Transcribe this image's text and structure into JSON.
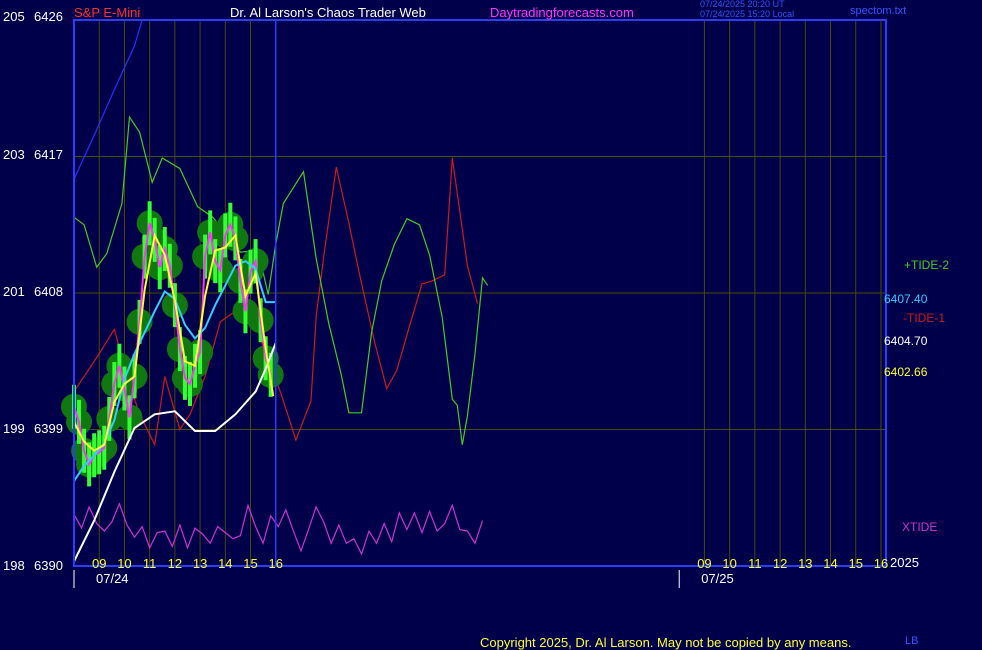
{
  "header": {
    "instrument": "S&P E-Mini",
    "site_title": "Dr. Al Larson's Chaos Trader Web",
    "site_url": "Daytradingforecasts.com",
    "timestamp_utc": "07/24/2025 20:20 UT",
    "timestamp_local": "07/24/2025 15:20 Local",
    "data_file": "spectom.txt"
  },
  "footer": {
    "copyright": "Copyright 2025, Dr. Al Larson. May not be copied by any means.",
    "initials": "LB"
  },
  "colors": {
    "background": "#00004a",
    "frame": "#2a3cff",
    "grid": "#4a4a00",
    "price_bars": "#33ff33",
    "moving_avg_fast": "#ffff33",
    "moving_avg_mid": "#33ccff",
    "moving_avg_slow": "#ffffff",
    "tide1": "#cc1a1a",
    "tide2": "#44cc22",
    "xtide": "#cc33cc",
    "bollinger_upper": "#2233ff"
  },
  "chart_data": {
    "type": "line",
    "title": "S&P E-Mini",
    "left_axis": {
      "labels": [
        {
          "degree": "205",
          "price": "6426"
        },
        {
          "degree": "203",
          "price": "6417"
        },
        {
          "degree": "201",
          "price": "6408"
        },
        {
          "degree": "199",
          "price": "6399"
        },
        {
          "degree": "198",
          "price": "6390"
        }
      ],
      "ylim": [
        6390,
        6426
      ]
    },
    "x_ticks": [
      "09",
      "10",
      "11",
      "12",
      "13",
      "14",
      "15",
      "16",
      "09",
      "10",
      "11",
      "12",
      "13",
      "14",
      "15",
      "16"
    ],
    "x_tick_hours": [
      9,
      10,
      11,
      12,
      13,
      14,
      15,
      16,
      33,
      34,
      35,
      36,
      37,
      38,
      39,
      40
    ],
    "dates": [
      {
        "label": "07/24",
        "hour": 8
      },
      {
        "label": "07/25",
        "hour": 32
      }
    ],
    "xlim": [
      8,
      40.2
    ],
    "now_hour": 16,
    "year_label": "2025",
    "price_labels": [
      {
        "text": "6407.40",
        "color": "#33ccff"
      },
      {
        "text": "6404.70",
        "color": "#ffffff"
      },
      {
        "text": "6402.66",
        "color": "#ffff33"
      }
    ],
    "legend": [
      {
        "text": "+TIDE-2",
        "color": "#44cc22"
      },
      {
        "text": "-TIDE-1",
        "color": "#cc1a1a"
      },
      {
        "text": "XTIDE",
        "color": "#cc33cc"
      }
    ],
    "series": {
      "price_close": [
        [
          8,
          6400.5
        ],
        [
          8.2,
          6399.5
        ],
        [
          8.4,
          6397.6
        ],
        [
          8.6,
          6396.7
        ],
        [
          8.8,
          6397.3
        ],
        [
          9.0,
          6397.5
        ],
        [
          9.2,
          6397.8
        ],
        [
          9.4,
          6399.7
        ],
        [
          9.6,
          6402.0
        ],
        [
          9.8,
          6403.2
        ],
        [
          10.0,
          6401.7
        ],
        [
          10.2,
          6399.8
        ],
        [
          10.4,
          6402.5
        ],
        [
          10.6,
          6406.1
        ],
        [
          10.8,
          6410.4
        ],
        [
          11.0,
          6412.6
        ],
        [
          11.2,
          6411.5
        ],
        [
          11.4,
          6409.7
        ],
        [
          11.6,
          6410.9
        ],
        [
          11.8,
          6409.8
        ],
        [
          12.0,
          6407.2
        ],
        [
          12.2,
          6404.3
        ],
        [
          12.4,
          6402.4
        ],
        [
          12.6,
          6402.0
        ],
        [
          12.8,
          6403.2
        ],
        [
          13.0,
          6404.1
        ],
        [
          13.2,
          6410.4
        ],
        [
          13.4,
          6412.0
        ],
        [
          13.6,
          6410.1
        ],
        [
          13.8,
          6409.5
        ],
        [
          14.0,
          6411.8
        ],
        [
          14.2,
          6412.5
        ],
        [
          14.4,
          6411.6
        ],
        [
          14.6,
          6408.8
        ],
        [
          14.8,
          6406.8
        ],
        [
          15.0,
          6409.4
        ],
        [
          15.2,
          6410.1
        ],
        [
          15.4,
          6406.2
        ],
        [
          15.6,
          6403.7
        ],
        [
          15.8,
          6402.6
        ]
      ],
      "ma_fast": [
        [
          8,
          6399.5
        ],
        [
          8.4,
          6398.2
        ],
        [
          8.8,
          6397.6
        ],
        [
          9.2,
          6398.0
        ],
        [
          9.6,
          6400.8
        ],
        [
          10.0,
          6402.0
        ],
        [
          10.4,
          6402.5
        ],
        [
          10.8,
          6408.2
        ],
        [
          11.2,
          6411.8
        ],
        [
          11.6,
          6410.5
        ],
        [
          12.0,
          6407.5
        ],
        [
          12.4,
          6403.5
        ],
        [
          12.8,
          6403.2
        ],
        [
          13.2,
          6407.8
        ],
        [
          13.6,
          6410.8
        ],
        [
          14.0,
          6411.0
        ],
        [
          14.4,
          6411.8
        ],
        [
          14.8,
          6407.8
        ],
        [
          15.2,
          6409.3
        ],
        [
          15.6,
          6404.3
        ],
        [
          15.9,
          6401.2
        ]
      ],
      "ma_mid": [
        [
          8,
          6395.6
        ],
        [
          8.4,
          6396.6
        ],
        [
          8.8,
          6397.3
        ],
        [
          9.2,
          6398.1
        ],
        [
          9.6,
          6399.6
        ],
        [
          10.0,
          6402.3
        ],
        [
          10.4,
          6404.0
        ],
        [
          10.8,
          6405.4
        ],
        [
          11.2,
          6406.8
        ],
        [
          11.6,
          6408.1
        ],
        [
          12.0,
          6407.6
        ],
        [
          12.4,
          6405.9
        ],
        [
          12.8,
          6405.0
        ],
        [
          13.2,
          6405.7
        ],
        [
          13.6,
          6407.2
        ],
        [
          14.0,
          6408.5
        ],
        [
          14.4,
          6409.8
        ],
        [
          14.8,
          6410.1
        ],
        [
          15.2,
          6409.6
        ],
        [
          15.6,
          6407.4
        ],
        [
          16.0,
          6407.4
        ]
      ],
      "ma_slow": [
        [
          8,
          6390.3
        ],
        [
          8.8,
          6393.0
        ],
        [
          9.6,
          6396.2
        ],
        [
          10.4,
          6399.1
        ],
        [
          11.2,
          6400.0
        ],
        [
          12.0,
          6400.2
        ],
        [
          12.8,
          6398.9
        ],
        [
          13.6,
          6398.9
        ],
        [
          14.4,
          6400.0
        ],
        [
          15.2,
          6401.5
        ],
        [
          15.6,
          6403.0
        ],
        [
          16.0,
          6404.7
        ]
      ],
      "bollinger_upper": [
        [
          8,
          6415.5
        ],
        [
          8.8,
          6418.4
        ],
        [
          9.6,
          6421.4
        ],
        [
          10.4,
          6424.3
        ],
        [
          10.7,
          6426
        ]
      ],
      "tide1": [
        [
          8,
          6401.5
        ],
        [
          9.0,
          6404.0
        ],
        [
          9.6,
          6405.6
        ],
        [
          10.2,
          6402.0
        ],
        [
          10.6,
          6400.0
        ],
        [
          11.2,
          6398.0
        ],
        [
          11.6,
          6402.5
        ],
        [
          12.2,
          6399.0
        ],
        [
          12.6,
          6400.0
        ],
        [
          13.2,
          6402.5
        ],
        [
          13.8,
          6406.1
        ],
        [
          14.4,
          6406.8
        ],
        [
          15.0,
          6407.0
        ],
        [
          15.6,
          6404.0
        ],
        [
          16.2,
          6401.4
        ],
        [
          16.8,
          6398.3
        ],
        [
          17.4,
          6400.9
        ],
        [
          17.6,
          6406.4
        ],
        [
          17.9,
          6410.4
        ],
        [
          18.4,
          6416.3
        ],
        [
          18.9,
          6412.6
        ],
        [
          19.3,
          6409.4
        ],
        [
          19.9,
          6404.9
        ],
        [
          20.4,
          6401.7
        ],
        [
          20.8,
          6402.9
        ],
        [
          21.3,
          6405.8
        ],
        [
          21.8,
          6408.6
        ],
        [
          22.2,
          6408.8
        ],
        [
          22.7,
          6409.2
        ],
        [
          23.0,
          6416.9
        ],
        [
          23.6,
          6409.8
        ],
        [
          24.0,
          6407.3
        ]
      ],
      "tide2": [
        [
          8,
          6413.0
        ],
        [
          8.4,
          6412.5
        ],
        [
          8.9,
          6409.7
        ],
        [
          9.3,
          6410.6
        ],
        [
          9.9,
          6413.9
        ],
        [
          10.2,
          6419.6
        ],
        [
          10.6,
          6418.6
        ],
        [
          11.1,
          6415.3
        ],
        [
          11.5,
          6416.9
        ],
        [
          12.2,
          6416.2
        ],
        [
          12.9,
          6413.7
        ],
        [
          13.5,
          6413.0
        ],
        [
          14.1,
          6411.8
        ],
        [
          14.6,
          6410.7
        ],
        [
          15.3,
          6410.8
        ],
        [
          15.7,
          6407.9
        ],
        [
          16.0,
          6411.2
        ],
        [
          16.3,
          6413.9
        ],
        [
          17.1,
          6416.0
        ],
        [
          17.6,
          6410.3
        ],
        [
          18.1,
          6406.0
        ],
        [
          18.6,
          6402.6
        ],
        [
          18.9,
          6400.1
        ],
        [
          19.4,
          6400.1
        ],
        [
          19.8,
          6405.4
        ],
        [
          20.2,
          6408.8
        ],
        [
          20.7,
          6411.2
        ],
        [
          21.2,
          6412.9
        ],
        [
          21.7,
          6412.5
        ],
        [
          22.1,
          6410.5
        ],
        [
          22.6,
          6406.4
        ],
        [
          23.0,
          6401.0
        ],
        [
          23.2,
          6400.6
        ],
        [
          23.4,
          6398.0
        ],
        [
          23.6,
          6399.9
        ],
        [
          23.9,
          6404.0
        ],
        [
          24.2,
          6409.0
        ],
        [
          24.4,
          6408.5
        ]
      ],
      "xtide": [
        [
          8,
          6393.4
        ],
        [
          8.3,
          6392.5
        ],
        [
          8.6,
          6393.9
        ],
        [
          8.9,
          6392.8
        ],
        [
          9.2,
          6392.3
        ],
        [
          9.5,
          6392.9
        ],
        [
          9.8,
          6394.1
        ],
        [
          10.1,
          6392.7
        ],
        [
          10.4,
          6391.9
        ],
        [
          10.7,
          6392.6
        ],
        [
          11.0,
          6391.2
        ],
        [
          11.3,
          6392.2
        ],
        [
          11.6,
          6392.3
        ],
        [
          11.9,
          6391.3
        ],
        [
          12.2,
          6392.7
        ],
        [
          12.5,
          6391.2
        ],
        [
          12.8,
          6392.5
        ],
        [
          13.1,
          6392.1
        ],
        [
          13.4,
          6391.5
        ],
        [
          13.7,
          6392.6
        ],
        [
          14.0,
          6392.2
        ],
        [
          14.3,
          6391.8
        ],
        [
          14.6,
          6392.0
        ],
        [
          14.9,
          6394.0
        ],
        [
          15.2,
          6392.6
        ],
        [
          15.5,
          6391.5
        ],
        [
          15.8,
          6393.3
        ],
        [
          16.1,
          6392.6
        ],
        [
          16.4,
          6393.7
        ],
        [
          16.7,
          6392.3
        ],
        [
          17.0,
          6391.0
        ],
        [
          17.3,
          6392.4
        ],
        [
          17.6,
          6393.9
        ],
        [
          17.9,
          6392.9
        ],
        [
          18.2,
          6391.5
        ],
        [
          18.5,
          6392.7
        ],
        [
          18.8,
          6391.5
        ],
        [
          19.1,
          6391.8
        ],
        [
          19.4,
          6390.8
        ],
        [
          19.7,
          6392.3
        ],
        [
          20.0,
          6391.5
        ],
        [
          20.3,
          6392.8
        ],
        [
          20.6,
          6391.6
        ],
        [
          20.9,
          6393.5
        ],
        [
          21.2,
          6392.4
        ],
        [
          21.5,
          6393.5
        ],
        [
          21.8,
          6392.2
        ],
        [
          22.1,
          6393.6
        ],
        [
          22.4,
          6392.3
        ],
        [
          22.7,
          6392.8
        ],
        [
          23.0,
          6394.0
        ],
        [
          23.3,
          6392.4
        ],
        [
          23.6,
          6392.3
        ],
        [
          23.9,
          6391.5
        ],
        [
          24.2,
          6393.0
        ]
      ]
    }
  }
}
